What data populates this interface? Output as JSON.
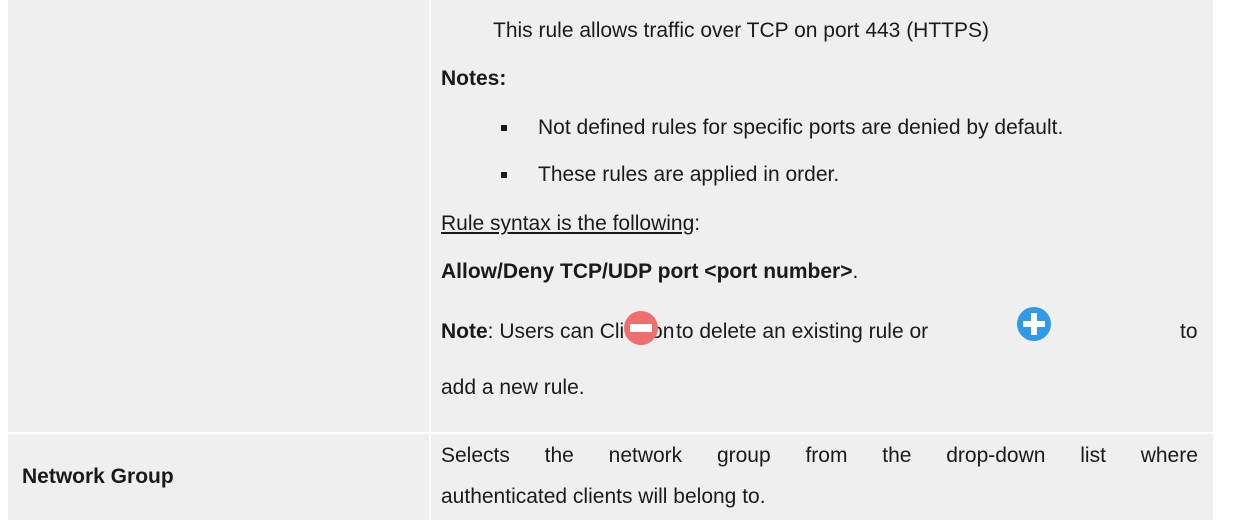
{
  "row1": {
    "intro_line": "This rule allows traffic over TCP on port 443 (HTTPS)",
    "notes_heading": "Notes:",
    "bullets": [
      "Not defined rules for specific ports are denied by default.",
      "These rules are applied in order."
    ],
    "syntax_label": "Rule syntax is the following",
    "syntax_colon": ":",
    "syntax_rule": "Allow/Deny TCP/UDP port <port number>",
    "syntax_period": ".",
    "note_label": "Note",
    "note_text_a": ": Users can Click on",
    "note_text_b": "to delete an existing rule or",
    "note_text_c": "to",
    "note_text_d": "add a new rule.",
    "icons": {
      "delete": "minus-circle-icon",
      "add": "plus-circle-icon"
    },
    "colors": {
      "delete_icon": "#ef6f70",
      "add_icon": "#2f9ae8"
    }
  },
  "row2": {
    "label": "Network Group",
    "description_line1": [
      "Selects",
      "the",
      "network",
      "group",
      "from",
      "the",
      "drop-down",
      "list",
      "where"
    ],
    "description_line2": "authenticated clients will belong to."
  }
}
